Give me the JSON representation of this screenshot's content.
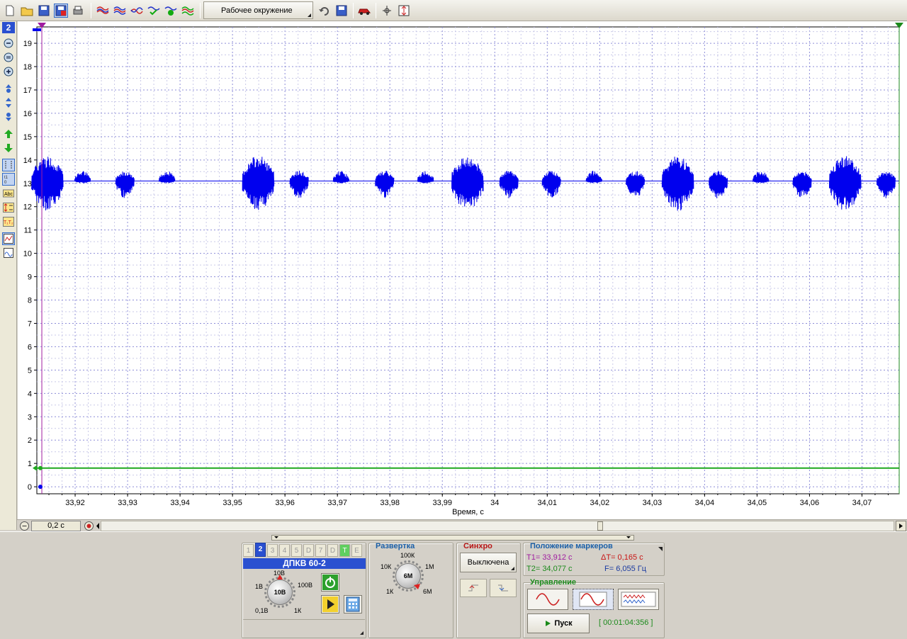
{
  "toolbar": {
    "workspace_label": "Рабочее окружение"
  },
  "left_toolbar": {
    "channel_number": "2"
  },
  "chart_data": {
    "type": "line",
    "xlabel": "Время, с",
    "x_ticks": [
      "33,92",
      "33,93",
      "33,94",
      "33,95",
      "33,96",
      "33,97",
      "33,98",
      "33,99",
      "34",
      "34,01",
      "34,02",
      "34,03",
      "34,04",
      "34,05",
      "34,06",
      "34,07"
    ],
    "y_ticks": [
      "0",
      "1",
      "2",
      "3",
      "4",
      "5",
      "6",
      "7",
      "8",
      "9",
      "10",
      "11",
      "12",
      "13",
      "14",
      "15",
      "16",
      "17",
      "18",
      "19"
    ],
    "xlim": [
      33.9127,
      34.0771
    ],
    "ylim": [
      -0.3,
      19.7
    ],
    "grid": true,
    "series": [
      {
        "color": "#0000ee",
        "baseline": 13.1,
        "burst_types": {
          "big": {
            "duration": 0.006,
            "amp_up": 1.1,
            "amp_down": 1.3
          },
          "mid": {
            "duration": 0.0035,
            "amp_up": 0.45,
            "amp_down": 0.75
          },
          "small": {
            "duration": 0.003,
            "amp_up": 0.45,
            "amp_down": 0.1
          }
        },
        "bursts": [
          {
            "t": 33.9147,
            "kind": "big"
          },
          {
            "t": 33.9214,
            "kind": "small"
          },
          {
            "t": 33.9295,
            "kind": "mid"
          },
          {
            "t": 33.9375,
            "kind": "small"
          },
          {
            "t": 33.9549,
            "kind": "big"
          },
          {
            "t": 33.9627,
            "kind": "mid"
          },
          {
            "t": 33.9707,
            "kind": "small"
          },
          {
            "t": 33.979,
            "kind": "mid"
          },
          {
            "t": 33.9868,
            "kind": "small"
          },
          {
            "t": 33.9948,
            "kind": "big"
          },
          {
            "t": 34.0027,
            "kind": "mid"
          },
          {
            "t": 34.0108,
            "kind": "mid"
          },
          {
            "t": 34.0189,
            "kind": "small"
          },
          {
            "t": 34.0268,
            "kind": "mid"
          },
          {
            "t": 34.0349,
            "kind": "big"
          },
          {
            "t": 34.0426,
            "kind": "mid"
          },
          {
            "t": 34.0507,
            "kind": "small"
          },
          {
            "t": 34.0586,
            "kind": "mid"
          },
          {
            "t": 34.0668,
            "kind": "big"
          },
          {
            "t": 34.0746,
            "kind": "mid"
          }
        ]
      },
      {
        "color": "#1fa81f",
        "constant": 0.8
      }
    ],
    "markers": {
      "t1": 33.9123,
      "t2": 34.0771
    }
  },
  "scroll": {
    "zoom_value": "0,2 с"
  },
  "channel_panel": {
    "tabs": [
      "1",
      "2",
      "3",
      "4",
      "5",
      "D",
      "7",
      "D",
      "T",
      "E"
    ],
    "active_tab": "2",
    "channel_name": "ДПКВ 60-2",
    "knob_value": "10В",
    "knob_scale": [
      "10В",
      "1В",
      "100В",
      "0,1В",
      "1К"
    ]
  },
  "sweep_panel": {
    "title": "Развертка",
    "knob_value": "6М",
    "knob_scale": [
      "100К",
      "10К",
      "1М",
      "1К",
      "6М"
    ]
  },
  "sync_panel": {
    "title": "Синхро",
    "state": "Выключена"
  },
  "markers_panel": {
    "title": "Положение маркеров",
    "t1": "T1= 33,912 с",
    "dt": "ΔT= 0,165 с",
    "t2": "T2= 34,077 с",
    "freq": "F= 6,055 Гц"
  },
  "control_panel": {
    "title": "Управление",
    "start_label": "Пуск",
    "elapsed": "[ 00:01:04:356 ]"
  }
}
